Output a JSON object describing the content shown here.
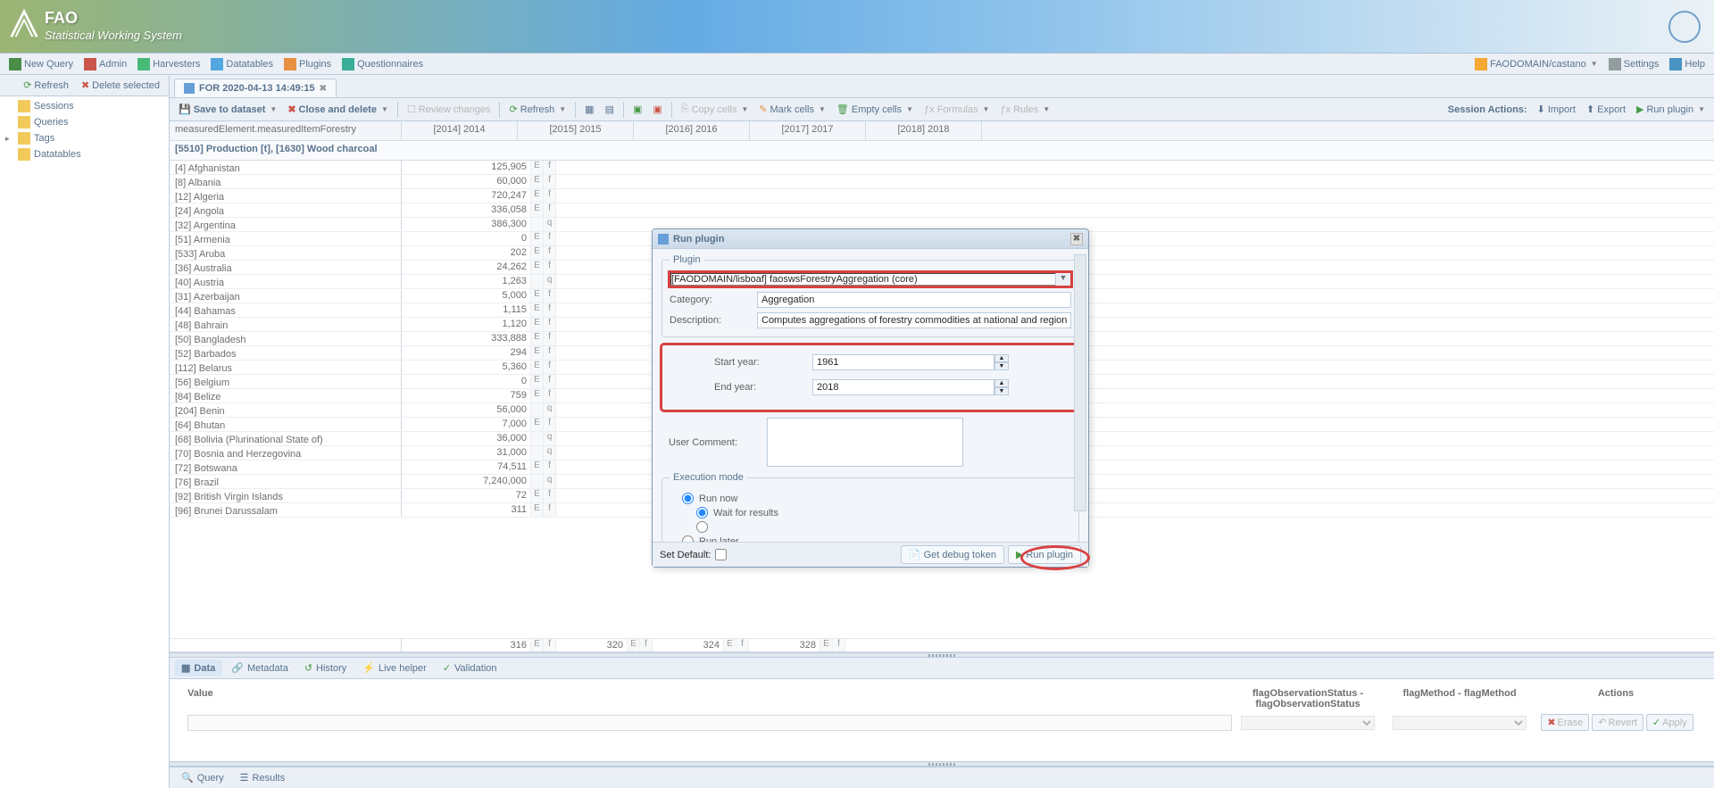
{
  "header": {
    "title": "FAO",
    "subtitle": "Statistical Working System"
  },
  "mainToolbar": {
    "left": [
      "New Query",
      "Admin",
      "Harvesters",
      "Datatables",
      "Plugins",
      "Questionnaires"
    ],
    "user": "FAODOMAIN/castano",
    "right": [
      "Settings",
      "Help"
    ]
  },
  "sidebar": {
    "refresh": "Refresh",
    "deleteSel": "Delete selected",
    "tree": [
      "Sessions",
      "Queries",
      "Tags",
      "Datatables"
    ]
  },
  "tab": {
    "label": "FOR 2020-04-13 14:49:15"
  },
  "actions": {
    "save": "Save to dataset",
    "close": "Close and delete",
    "review": "Review changes",
    "refresh": "Refresh",
    "copy": "Copy cells",
    "mark": "Mark cells",
    "empty": "Empty cells",
    "formulas": "Formulas",
    "rules": "Rules",
    "sessionLabel": "Session Actions:",
    "import": "Import",
    "export": "Export",
    "run": "Run plugin"
  },
  "grid": {
    "rowHeaderLabel": "measuredElement.measuredItemForestry",
    "years": [
      "[2014] 2014",
      "[2015] 2015",
      "[2016] 2016",
      "[2017] 2017",
      "[2018] 2018"
    ],
    "subheader": "[5510] Production [t], [1630] Wood charcoal",
    "rows": [
      {
        "label": "[4] Afghanistan",
        "val": "125,905",
        "f1": "E",
        "f2": "f"
      },
      {
        "label": "[8] Albania",
        "val": "60,000",
        "f1": "E",
        "f2": "f"
      },
      {
        "label": "[12] Algeria",
        "val": "720,247",
        "f1": "E",
        "f2": "f"
      },
      {
        "label": "[24] Angola",
        "val": "336,058",
        "f1": "E",
        "f2": "f"
      },
      {
        "label": "[32] Argentina",
        "val": "386,300",
        "f1": "",
        "f2": "q"
      },
      {
        "label": "[51] Armenia",
        "val": "0",
        "f1": "E",
        "f2": "f"
      },
      {
        "label": "[533] Aruba",
        "val": "202",
        "f1": "E",
        "f2": "f"
      },
      {
        "label": "[36] Australia",
        "val": "24,262",
        "f1": "E",
        "f2": "f"
      },
      {
        "label": "[40] Austria",
        "val": "1,263",
        "f1": "",
        "f2": "q"
      },
      {
        "label": "[31] Azerbaijan",
        "val": "5,000",
        "f1": "E",
        "f2": "f"
      },
      {
        "label": "[44] Bahamas",
        "val": "1,115",
        "f1": "E",
        "f2": "f"
      },
      {
        "label": "[48] Bahrain",
        "val": "1,120",
        "f1": "E",
        "f2": "f"
      },
      {
        "label": "[50] Bangladesh",
        "val": "333,888",
        "f1": "E",
        "f2": "f"
      },
      {
        "label": "[52] Barbados",
        "val": "294",
        "f1": "E",
        "f2": "f"
      },
      {
        "label": "[112] Belarus",
        "val": "5,360",
        "f1": "E",
        "f2": "f"
      },
      {
        "label": "[56] Belgium",
        "val": "0",
        "f1": "E",
        "f2": "f"
      },
      {
        "label": "[84] Belize",
        "val": "759",
        "f1": "E",
        "f2": "f"
      },
      {
        "label": "[204] Benin",
        "val": "56,000",
        "f1": "",
        "f2": "q"
      },
      {
        "label": "[64] Bhutan",
        "val": "7,000",
        "f1": "E",
        "f2": "f"
      },
      {
        "label": "[68] Bolivia (Plurinational State of)",
        "val": "36,000",
        "f1": "",
        "f2": "q"
      },
      {
        "label": "[70] Bosnia and Herzegovina",
        "val": "31,000",
        "f1": "",
        "f2": "q"
      },
      {
        "label": "[72] Botswana",
        "val": "74,511",
        "f1": "E",
        "f2": "f"
      },
      {
        "label": "[76] Brazil",
        "val": "7,240,000",
        "f1": "",
        "f2": "q"
      },
      {
        "label": "[92] British Virgin Islands",
        "val": "72",
        "f1": "E",
        "f2": "f"
      },
      {
        "label": "[96] Brunei Darussalam",
        "val": "311",
        "f1": "E",
        "f2": "f"
      }
    ],
    "bottomRow": {
      "c1": "316",
      "c2": "320",
      "c3": "324",
      "c4": "328",
      "f1": "E",
      "f2": "f"
    }
  },
  "bottomTabs": [
    "Data",
    "Metadata",
    "History",
    "Live helper",
    "Validation"
  ],
  "detail": {
    "value": "Value",
    "flagObs": "flagObservationStatus - flagObservationStatus",
    "flagMethod": "flagMethod - flagMethod",
    "actions": "Actions",
    "erase": "Erase",
    "revert": "Revert",
    "apply": "Apply"
  },
  "footerTabs": [
    "Query",
    "Results"
  ],
  "modal": {
    "title": "Run plugin",
    "pluginLegend": "Plugin",
    "pluginVal": "[FAODOMAIN/lisboaf] faoswsForestryAggregation (core)",
    "category": "Category:",
    "categoryVal": "Aggregation",
    "desc": "Description:",
    "descVal": "Computes aggregations of forestry commodities at national and regional levels.",
    "startYear": "Start year:",
    "startYearVal": "1961",
    "endYear": "End year:",
    "endYearVal": "2018",
    "userComment": "User Comment:",
    "execLegend": "Execution mode",
    "runNow": "Run now",
    "waitResults": "Wait for results",
    "runLater": "Run later",
    "setDefault": "Set Default:",
    "getDebug": "Get debug token",
    "runPlugin": "Run plugin"
  }
}
